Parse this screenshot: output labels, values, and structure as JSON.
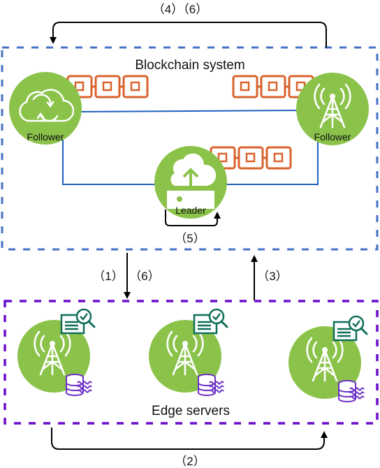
{
  "diagram": {
    "blockchain_system": {
      "title": "Blockchain system",
      "border_color": "#4472C4",
      "nodes": [
        {
          "role": "follower",
          "label": "Follower",
          "icon": "cloud-sync-icon"
        },
        {
          "role": "follower",
          "label": "Follower",
          "icon": "cell-tower-icon"
        },
        {
          "role": "leader",
          "label": "Leader",
          "icon": "cloud-upload-server-icon"
        }
      ],
      "chain_icon": "blockchain-chain-icon",
      "link_color": "#1F5FBF"
    },
    "edge_servers": {
      "title": "Edge servers",
      "border_color": "#6A0DCC",
      "servers": [
        {
          "icon": "cell-tower-icon",
          "badges": [
            "document-verify-icon",
            "database-stream-icon"
          ]
        },
        {
          "icon": "cell-tower-icon",
          "badges": [
            "document-verify-icon",
            "database-stream-icon"
          ]
        },
        {
          "icon": "cell-tower-icon",
          "badges": [
            "document-verify-icon",
            "database-stream-icon"
          ]
        }
      ]
    },
    "steps": {
      "top_loop": "（4）（6）",
      "leader_loop": "（5）",
      "down_left": "（1）",
      "down_right": "（6）",
      "up": "（3）",
      "bottom_loop": "（2）"
    },
    "colors": {
      "node_green": "#8BC34A",
      "chain_orange": "#D9622B",
      "doc_teal": "#0F6E5A",
      "db_purple": "#6B2FC4",
      "arrow": "#000000"
    }
  }
}
